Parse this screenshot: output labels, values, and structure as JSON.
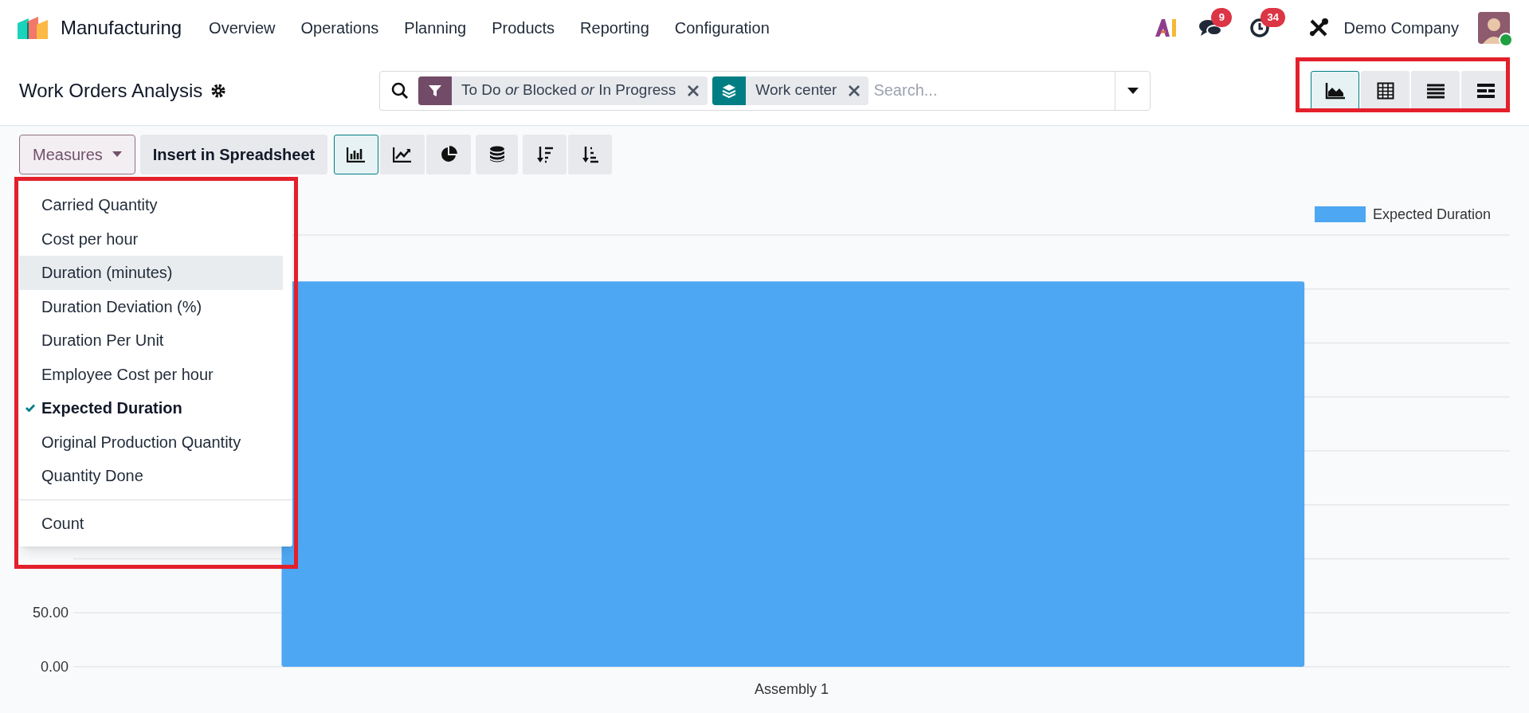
{
  "navbar": {
    "app_name": "Manufacturing",
    "menu": [
      "Overview",
      "Operations",
      "Planning",
      "Products",
      "Reporting",
      "Configuration"
    ],
    "messages_count": "9",
    "activities_count": "34",
    "company": "Demo Company",
    "online": true
  },
  "control_panel": {
    "title": "Work Orders Analysis",
    "facets": [
      {
        "kind": "filter",
        "text": "To Do *or* Blocked *or* In Progress"
      },
      {
        "kind": "group",
        "text": "Work center"
      }
    ],
    "search_placeholder": "Search...",
    "views": [
      {
        "kind": "graph",
        "selected": true
      },
      {
        "kind": "pivot",
        "selected": false
      },
      {
        "kind": "list",
        "selected": false
      },
      {
        "kind": "gantt",
        "selected": false
      }
    ]
  },
  "toolbar": {
    "measures_label": "Measures",
    "insert_label": "Insert in Spreadsheet",
    "chart_types": [
      {
        "kind": "bar",
        "selected": true
      },
      {
        "kind": "line",
        "selected": false
      },
      {
        "kind": "pie",
        "selected": false
      }
    ],
    "stacked": false,
    "sort_buttons": [
      {
        "kind": "descending"
      },
      {
        "kind": "ascending"
      }
    ]
  },
  "measures_menu": {
    "items": [
      {
        "label": "Carried Quantity",
        "checked": false,
        "highlighted": false
      },
      {
        "label": "Cost per hour",
        "checked": false,
        "highlighted": false
      },
      {
        "label": "Duration (minutes)",
        "checked": false,
        "highlighted": true
      },
      {
        "label": "Duration Deviation (%)",
        "checked": false,
        "highlighted": false
      },
      {
        "label": "Duration Per Unit",
        "checked": false,
        "highlighted": false
      },
      {
        "label": "Employee Cost per hour",
        "checked": false,
        "highlighted": false
      },
      {
        "label": "Expected Duration",
        "checked": true,
        "highlighted": false
      },
      {
        "label": "Original Production Quantity",
        "checked": false,
        "highlighted": false
      },
      {
        "label": "Quantity Done",
        "checked": false,
        "highlighted": false
      }
    ],
    "count_item": {
      "label": "Count",
      "checked": false,
      "highlighted": false
    }
  },
  "chart_data": {
    "type": "bar",
    "categories": [
      "Assembly 1"
    ],
    "series": [
      {
        "name": "Expected Duration",
        "color": "#4ea7f2",
        "values": [
          357
        ]
      }
    ],
    "ylim": [
      0,
      400
    ],
    "yticks": [
      {
        "value": 0,
        "label": "0.00"
      },
      {
        "value": 50,
        "label": "50.00"
      }
    ]
  }
}
